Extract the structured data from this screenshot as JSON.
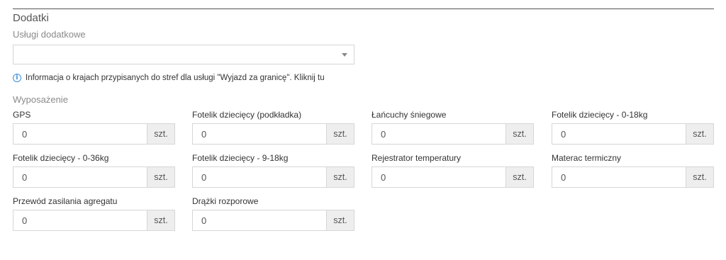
{
  "section": {
    "title": "Dodatki"
  },
  "services": {
    "label": "Usługi dodatkowe",
    "selected": ""
  },
  "info": {
    "text": "Informacja o krajach przypisanych do stref dla usługi \"Wyjazd za granicę\". Kliknij tu"
  },
  "equipment": {
    "label": "Wyposażenie",
    "items": [
      {
        "label": "GPS",
        "value": "0",
        "unit": "szt."
      },
      {
        "label": "Fotelik dziecięcy (podkładka)",
        "value": "0",
        "unit": "szt."
      },
      {
        "label": "Łańcuchy śniegowe",
        "value": "0",
        "unit": "szt."
      },
      {
        "label": "Fotelik dziecięcy - 0-18kg",
        "value": "0",
        "unit": "szt."
      },
      {
        "label": "Fotelik dziecięcy - 0-36kg",
        "value": "0",
        "unit": "szt."
      },
      {
        "label": "Fotelik dziecięcy - 9-18kg",
        "value": "0",
        "unit": "szt."
      },
      {
        "label": "Rejestrator temperatury",
        "value": "0",
        "unit": "szt."
      },
      {
        "label": "Materac termiczny",
        "value": "0",
        "unit": "szt."
      },
      {
        "label": "Przewód zasilania agregatu",
        "value": "0",
        "unit": "szt."
      },
      {
        "label": "Drążki rozporowe",
        "value": "0",
        "unit": "szt."
      }
    ]
  },
  "colors": {
    "info_icon": "#3c8fd8",
    "unit_bg": "#eeeeee",
    "border": "#d6d6d6"
  }
}
